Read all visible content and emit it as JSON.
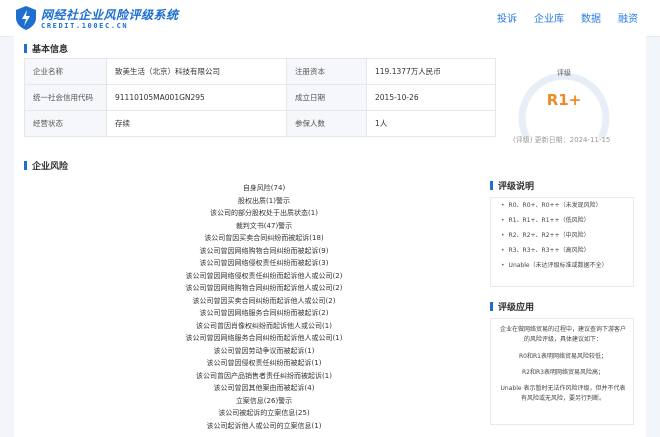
{
  "header": {
    "logo_name": "网经社企业风险评级系统",
    "logo_domain": "CREDIT.100EC.CN",
    "nav": [
      "投诉",
      "企业库",
      "数据",
      "融资"
    ]
  },
  "basic_info": {
    "title": "基本信息",
    "rows": [
      [
        "企业名称",
        "致美生活（北京）科技有限公司",
        "注册资本",
        "119.1377万人民币"
      ],
      [
        "统一社会信用代码",
        "91110105MA001GN295",
        "成立日期",
        "2015-10-26"
      ],
      [
        "经营状态",
        "存续",
        "参保人数",
        "1人"
      ]
    ]
  },
  "rating": {
    "label": "评级",
    "value": "R1+",
    "updated": "(评级) 更新日期：2024-11-15",
    "accent": "#f08a24"
  },
  "risk": {
    "title": "企业风险",
    "items": [
      "自身风险(74)",
      "股权出质(1)警示",
      "该公司的部分股权处于出质状态(1)",
      "裁判文书(47)警示",
      "该公司曾因买卖合同纠纷而被起诉(18)",
      "该公司曾因网络购物合同纠纷而被起诉(9)",
      "该公司曾因网络侵权责任纠纷而被起诉(3)",
      "该公司曾因网络侵权责任纠纷而起诉他人或公司(2)",
      "该公司曾因网络购物合同纠纷而起诉他人或公司(2)",
      "该公司曾因买卖合同纠纷而起诉他人或公司(2)",
      "该公司曾因网络服务合同纠纷而被起诉(2)",
      "该公司曾因肖像权纠纷而起诉他人或公司(1)",
      "该公司曾因网络服务合同纠纷而起诉他人或公司(1)",
      "该公司曾因劳动争议而被起诉(1)",
      "该公司曾因侵权责任纠纷而被起诉(1)",
      "该公司曾因产品销售者责任纠纷而被起诉(1)",
      "该公司曾因其他案由而被起诉(4)",
      "立案信息(26)警示",
      "该公司被起诉的立案信息(25)",
      "该公司起诉他人或公司的立案信息(1)"
    ]
  },
  "rating_legend": {
    "title": "评级说明",
    "items": [
      "R0、R0+、R0++（未发现风险）",
      "R1、R1+、R1++（低风险）",
      "R2、R2+、R2++（中风险）",
      "R3、R3+、R3++（高风险）",
      "Unable（未达评级标准或数据不全）"
    ]
  },
  "rating_apply": {
    "title": "评级应用",
    "intro": "企业在做网络贸易的过程中，建议查询下游客户的风险评级，具体建议如下：",
    "items": [
      "R0和R1表明网络贸易风险较低；",
      "R2和R3表明网络贸易风险高；",
      "Unable 表示暂时无法作风险评级，但并不代表有风险或无风险，要另行判断。"
    ]
  }
}
